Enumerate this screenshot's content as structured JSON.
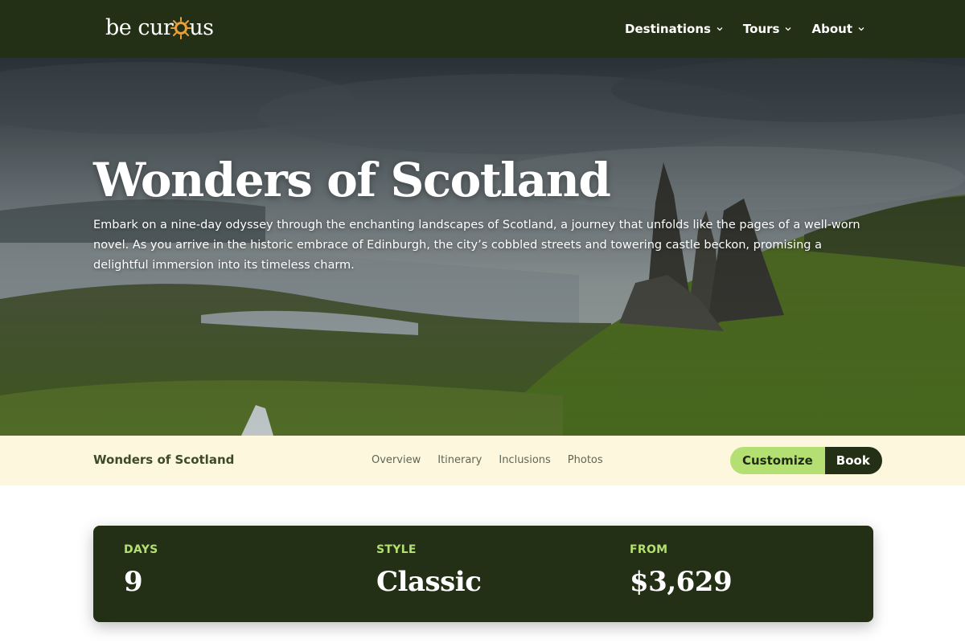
{
  "brand": {
    "logo_text_before": "be cur",
    "logo_text_after": "us",
    "logo_accent_color": "#e8a13a"
  },
  "nav": {
    "items": [
      {
        "label": "Destinations",
        "icon": "chevron-down-icon"
      },
      {
        "label": "Tours",
        "icon": "chevron-down-icon"
      },
      {
        "label": "About",
        "icon": "chevron-down-icon"
      }
    ]
  },
  "hero": {
    "title": "Wonders of Scotland",
    "description": "Embark on a nine-day odyssey through the enchanting landscapes of Scotland, a journey that unfolds like the pages of a well-worn novel. As you arrive in the historic embrace of Edinburgh, the city’s cobbled streets and towering castle beckon, promising a delightful immersion into its timeless charm."
  },
  "subnav": {
    "title": "Wonders of Scotland",
    "links": [
      "Overview",
      "Itinerary",
      "Inclusions",
      "Photos"
    ],
    "customize_label": "Customize",
    "book_label": "Book"
  },
  "stats": [
    {
      "label": "DAYS",
      "value": "9"
    },
    {
      "label": "STYLE",
      "value": "Classic"
    },
    {
      "label": "FROM",
      "value": "$3,629"
    }
  ],
  "colors": {
    "primary_dark": "#243015",
    "accent_green": "#b4df72",
    "subnav_bg": "#fdf7dd"
  }
}
